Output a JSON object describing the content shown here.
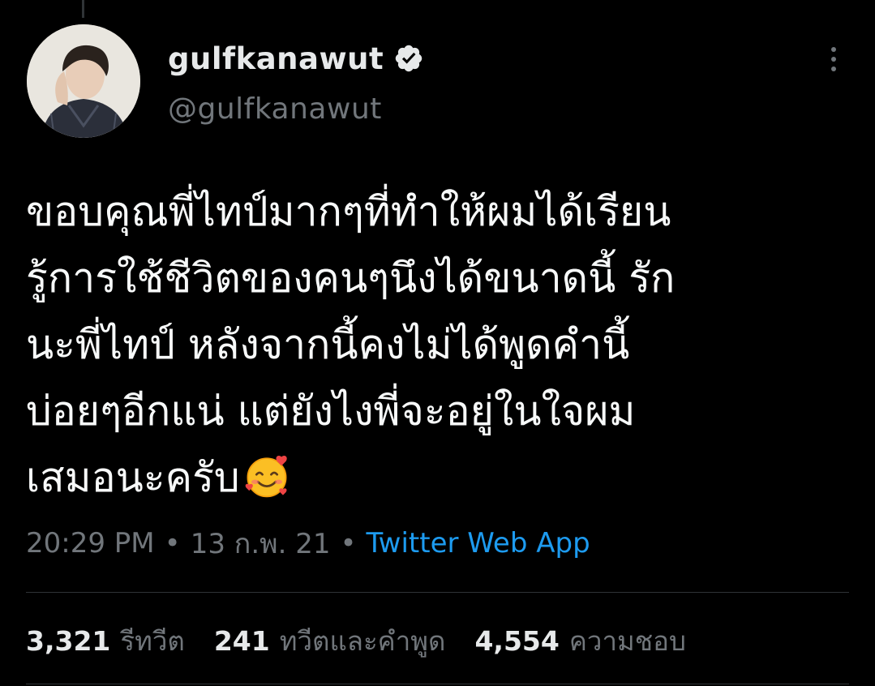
{
  "tweet": {
    "display_name": "gulfkanawut",
    "handle": "@gulfkanawut",
    "text_lines": [
      "ขอบคุณพี่ไทป์มากๆที่ทำให้ผมได้เรียน",
      "รู้การใช้ชีวิตของคนๆนึงได้ขนาดนี้ รัก",
      "นะพี่ไทป์ หลังจากนี้คงไม่ได้พูดคำนี้",
      "บ่อยๆอีกแน่ แต่ยังไงพี่จะอยู่ในใจผม",
      "เสมอนะครับ"
    ],
    "emoji": "smiling-face-with-hearts-emoji",
    "time": "20:29 PM",
    "date": "13 ก.พ. 21",
    "separator": "•",
    "source": "Twitter Web App"
  },
  "stats": {
    "retweets_count": "3,321",
    "retweets_label": "รีทวีต",
    "quotes_count": "241",
    "quotes_label": "ทวีตและคำพูด",
    "likes_count": "4,554",
    "likes_label": "ความชอบ"
  },
  "colors": {
    "background": "#000000",
    "text": "#e7e9ea",
    "secondary": "#71767b",
    "link": "#1d9bf0",
    "divider": "#2f3336"
  },
  "icons": {
    "verified": "verified-badge-icon",
    "more": "more-options-icon",
    "avatar": "profile-avatar"
  }
}
